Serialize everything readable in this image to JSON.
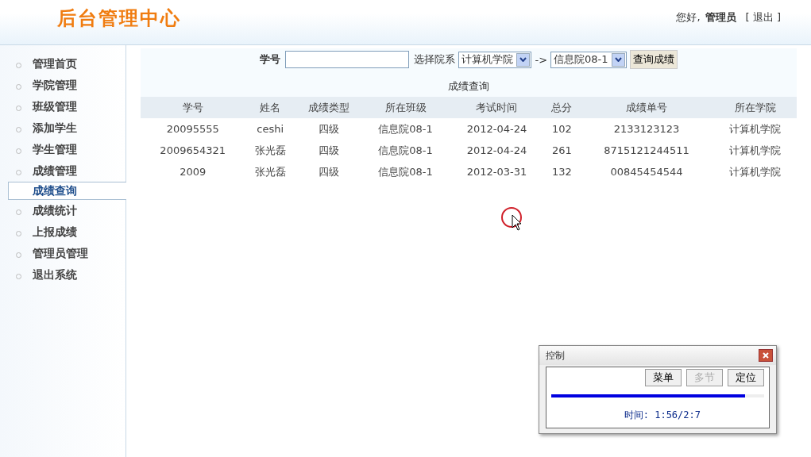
{
  "header": {
    "title": "后台管理中心",
    "greeting": "您好,",
    "user": "管理员",
    "logout": "[ 退出 ]"
  },
  "sidebar": {
    "items": [
      {
        "label": "管理首页",
        "selected": false
      },
      {
        "label": "学院管理",
        "selected": false
      },
      {
        "label": "班级管理",
        "selected": false
      },
      {
        "label": "添加学生",
        "selected": false
      },
      {
        "label": "学生管理",
        "selected": false
      },
      {
        "label": "成绩管理",
        "selected": false
      },
      {
        "label": "成绩查询",
        "selected": true
      },
      {
        "label": "成绩统计",
        "selected": false
      },
      {
        "label": "上报成绩",
        "selected": false
      },
      {
        "label": "管理员管理",
        "selected": false
      },
      {
        "label": "退出系统",
        "selected": false
      }
    ]
  },
  "search": {
    "id_label": "学号",
    "dept_label": "选择院系",
    "dept": "计算机学院",
    "arrow": "->",
    "class": "信息院08-1",
    "button": "查询成绩"
  },
  "table": {
    "title": "成绩查询",
    "columns": [
      "学号",
      "姓名",
      "成绩类型",
      "所在班级",
      "考试时间",
      "总分",
      "成绩单号",
      "所在学院"
    ],
    "rows": [
      [
        "20095555",
        "ceshi",
        "四级",
        "信息院08-1",
        "2012-04-24",
        "102",
        "2133123123",
        "计算机学院"
      ],
      [
        "2009654321",
        "张光磊",
        "四级",
        "信息院08-1",
        "2012-04-24",
        "261",
        "8715121244511",
        "计算机学院"
      ],
      [
        "2009",
        "张光磊",
        "四级",
        "信息院08-1",
        "2012-03-31",
        "132",
        "00845454544",
        "计算机学院"
      ]
    ]
  },
  "control_window": {
    "title": "控制",
    "buttons": [
      {
        "label": "菜单",
        "disabled": false
      },
      {
        "label": "多节",
        "disabled": true
      },
      {
        "label": "定位",
        "disabled": false
      }
    ],
    "level": 0.91,
    "time": "时间: 1:56/2:7"
  }
}
